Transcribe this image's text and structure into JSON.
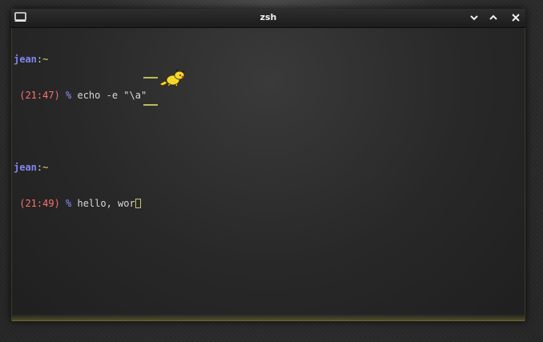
{
  "window": {
    "title": "zsh",
    "app_icon": "terminal-icon",
    "controls": [
      {
        "name": "minimize",
        "icon": "chevron-down-icon"
      },
      {
        "name": "maximize",
        "icon": "chevron-up-icon"
      },
      {
        "name": "close",
        "icon": "close-icon"
      }
    ]
  },
  "terminal": {
    "session1": {
      "user": "jean",
      "colon": ":",
      "dir": "~",
      "time": " (21:47)",
      "prompt": " %",
      "command": " echo -e \"\\a\""
    },
    "session2": {
      "user": "jean",
      "colon": ":",
      "dir": "~",
      "time": " (21:49)",
      "prompt": " %",
      "command": " hello, wor"
    }
  },
  "colors": {
    "user": "#7f86f0",
    "time": "#ff6f6f",
    "prompt": "#8c92ff",
    "text": "#d8d8d8",
    "dir": "#e3dc7a",
    "accent": "#c9c36a"
  }
}
